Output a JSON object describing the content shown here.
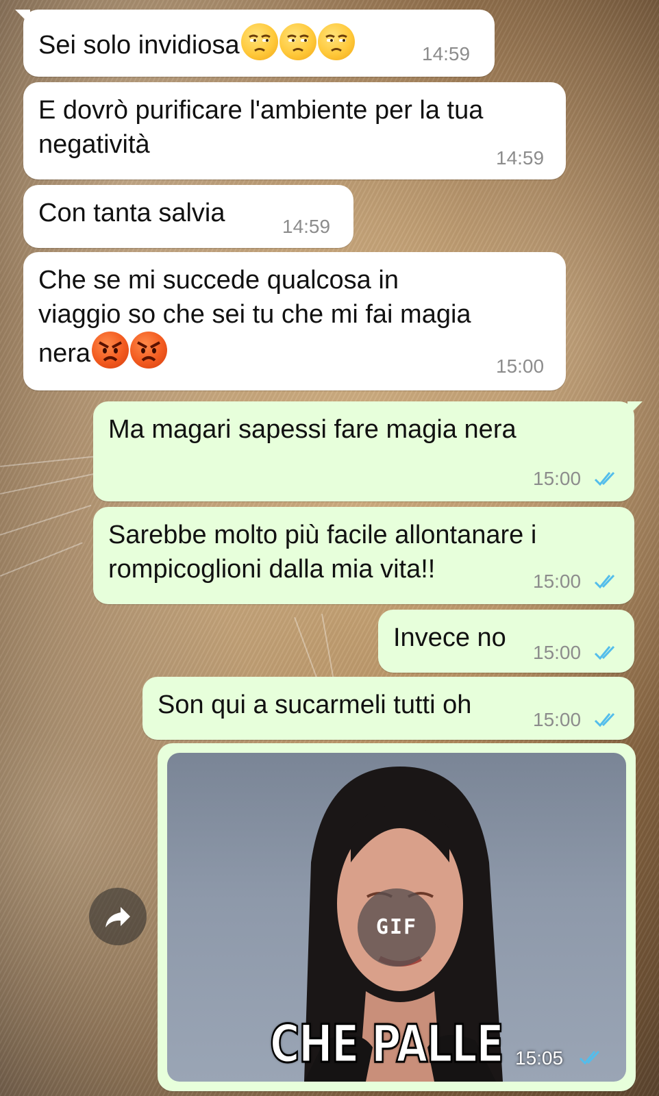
{
  "messages": [
    {
      "id": 1,
      "direction": "incoming",
      "text": "Sei solo invidiosa",
      "emoji": [
        "unamused",
        "unamused",
        "unamused"
      ],
      "time": "14:59"
    },
    {
      "id": 2,
      "direction": "incoming",
      "line1": "E dovrò purificare l'ambiente per la tua",
      "line2": "negatività",
      "time": "14:59"
    },
    {
      "id": 3,
      "direction": "incoming",
      "text": "Con tanta salvia",
      "time": "14:59"
    },
    {
      "id": 4,
      "direction": "incoming",
      "line1": "Che se mi succede qualcosa in",
      "line2": "viaggio so che sei tu che mi fai magia",
      "line3": "nera",
      "emoji": [
        "angry",
        "angry"
      ],
      "time": "15:00"
    },
    {
      "id": 5,
      "direction": "outgoing",
      "text": "Ma magari sapessi fare magia nera",
      "time": "15:00",
      "status": "read"
    },
    {
      "id": 6,
      "direction": "outgoing",
      "line1": "Sarebbe molto più facile allontanare i",
      "line2": "rompicoglioni dalla mia vita!!",
      "time": "15:00",
      "status": "read"
    },
    {
      "id": 7,
      "direction": "outgoing",
      "text": "Invece no",
      "time": "15:00",
      "status": "read"
    },
    {
      "id": 8,
      "direction": "outgoing",
      "text": "Son qui a sucarmeli tutti oh",
      "time": "15:00",
      "status": "read"
    },
    {
      "id": 9,
      "direction": "outgoing",
      "type": "gif",
      "badge": "GIF",
      "caption": "CHE PALLE",
      "time": "15:05",
      "status": "read"
    }
  ],
  "icons": {
    "forward": "forward-arrow-icon",
    "read_receipt": "double-check-icon",
    "gif": "gif-play-icon"
  },
  "colors": {
    "incoming_bubble": "#ffffff",
    "outgoing_bubble": "#e7ffdb",
    "timestamp": "#8c8c8c",
    "read_ticks": "#53bdeb"
  }
}
